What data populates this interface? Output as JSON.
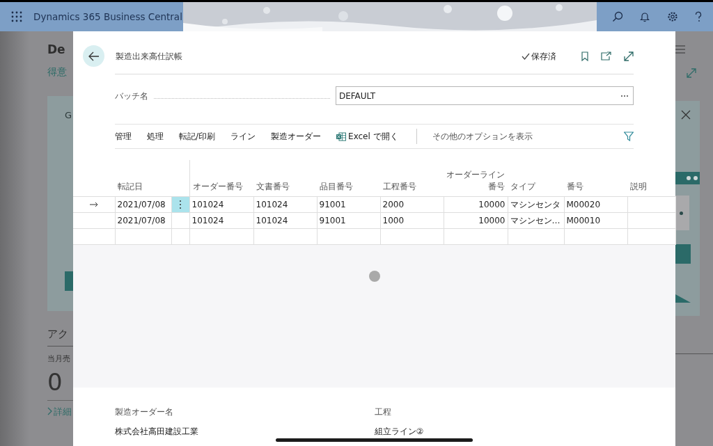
{
  "app_bar": {
    "title": "Dynamics 365 Business Central"
  },
  "background_page": {
    "heading": "De",
    "link": "得意",
    "card_texts": [
      "G"
    ],
    "section_title": "アク",
    "kpi_label": "当月売",
    "kpi_value": "0",
    "details_link": "詳細"
  },
  "dialog": {
    "title": "製造出来高仕訳帳",
    "save_status": "保存済",
    "batch": {
      "label": "バッチ名",
      "value": "DEFAULT"
    },
    "actions": [
      {
        "label": "管理",
        "kind": "menu"
      },
      {
        "label": "処理",
        "kind": "menu"
      },
      {
        "label": "転記/印刷",
        "kind": "menu"
      },
      {
        "label": "ライン",
        "kind": "menu"
      },
      {
        "label": "製造オーダー",
        "kind": "menu"
      },
      {
        "label": "Excel で開く",
        "kind": "excel"
      },
      {
        "label": "その他のオプションを表示",
        "kind": "more"
      }
    ],
    "table": {
      "columns": [
        {
          "label": "転記日",
          "kind": "text"
        },
        {
          "label": "オーダー番号",
          "kind": "text"
        },
        {
          "label": "文書番号",
          "kind": "text"
        },
        {
          "label": "品目番号",
          "kind": "text"
        },
        {
          "label": "工程番号",
          "kind": "text"
        },
        {
          "label": "オーダーライン番号",
          "kind": "number"
        },
        {
          "label": "タイプ",
          "kind": "text"
        },
        {
          "label": "番号",
          "kind": "text"
        },
        {
          "label": "説明",
          "kind": "text"
        }
      ],
      "rows": [
        {
          "selected": true,
          "cells": [
            "2021/07/08",
            "101024",
            "101024",
            "91001",
            "2000",
            "10000",
            "マシンセンタ",
            "M00020",
            ""
          ]
        },
        {
          "selected": false,
          "cells": [
            "2021/07/08",
            "101024",
            "101024",
            "91001",
            "1000",
            "10000",
            "マシンセン…",
            "M00010",
            ""
          ]
        },
        {
          "selected": false,
          "cells": [
            "",
            "",
            "",
            "",
            "",
            "",
            "",
            "",
            ""
          ]
        }
      ]
    },
    "details": [
      {
        "label": "製造オーダー名",
        "value": "株式会社高田建設工業"
      },
      {
        "label": "工程",
        "value": "組立ライン②"
      }
    ]
  }
}
